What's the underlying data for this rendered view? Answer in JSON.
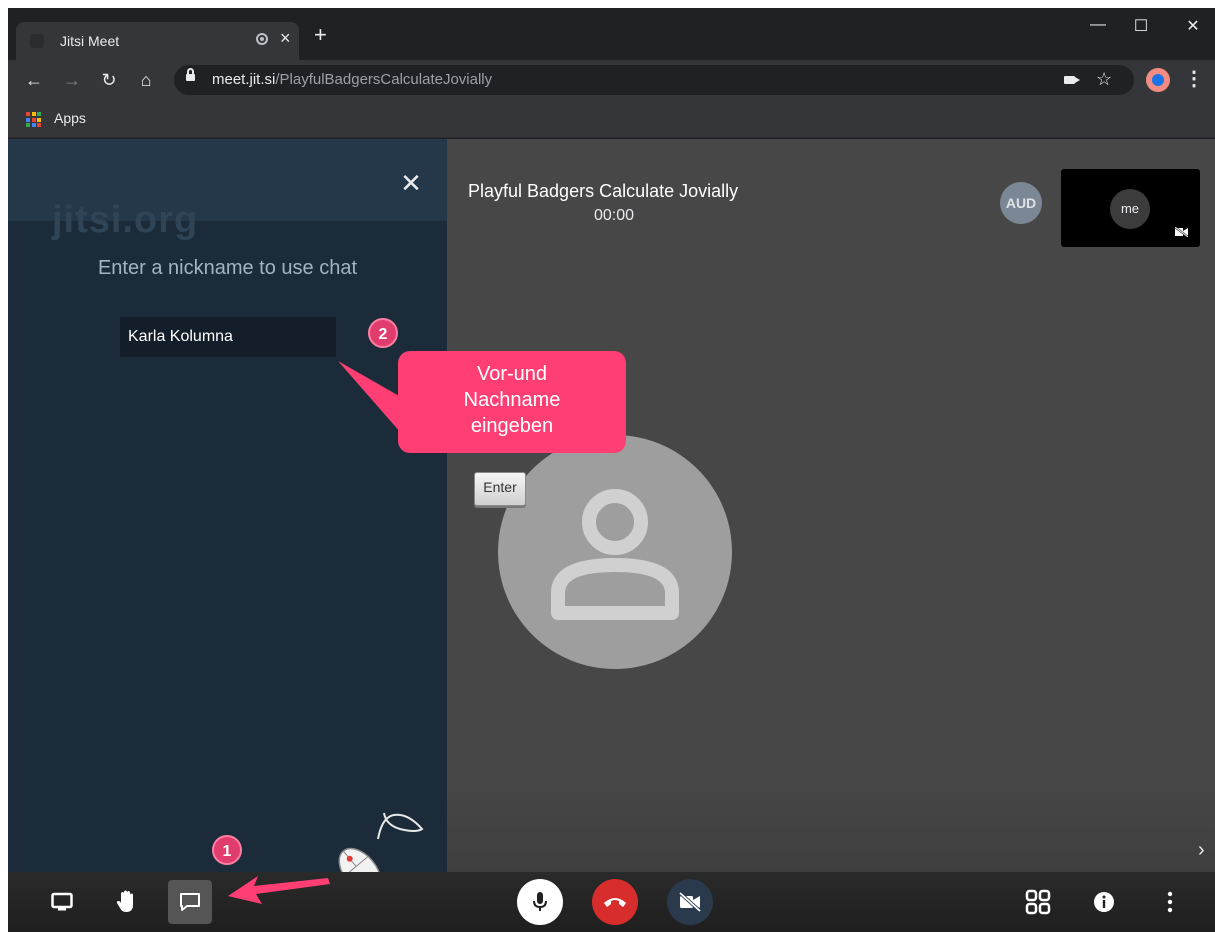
{
  "browser": {
    "tab_title": "Jitsi Meet",
    "url_host": "meet.jit.si",
    "url_path": "/PlayfulBadgersCalculateJovially",
    "bookmark_apps_label": "Apps"
  },
  "chat": {
    "watermark": "jitsi.org",
    "prompt": "Enter a nickname to use chat",
    "nickname_value": "Karla Kolumna"
  },
  "meeting": {
    "title": "Playful Badgers Calculate Jovially",
    "timer": "00:00",
    "remote_avatar_label": "AUD",
    "self_label": "me"
  },
  "annotations": {
    "step1": "1",
    "step2": "2",
    "callout_line1": "Vor-und",
    "callout_line2": "Nachname",
    "callout_line3": "eingeben",
    "enter_key": "Enter",
    "mouse_clicks": "1x",
    "accent_color": "#ff3f74"
  },
  "icons": {
    "toolbar_left": [
      "screen-share-icon",
      "raise-hand-icon",
      "chat-icon"
    ],
    "toolbar_center": [
      "microphone-icon",
      "hangup-icon",
      "camera-off-icon"
    ],
    "toolbar_right": [
      "tile-view-icon",
      "info-icon",
      "more-icon"
    ]
  }
}
